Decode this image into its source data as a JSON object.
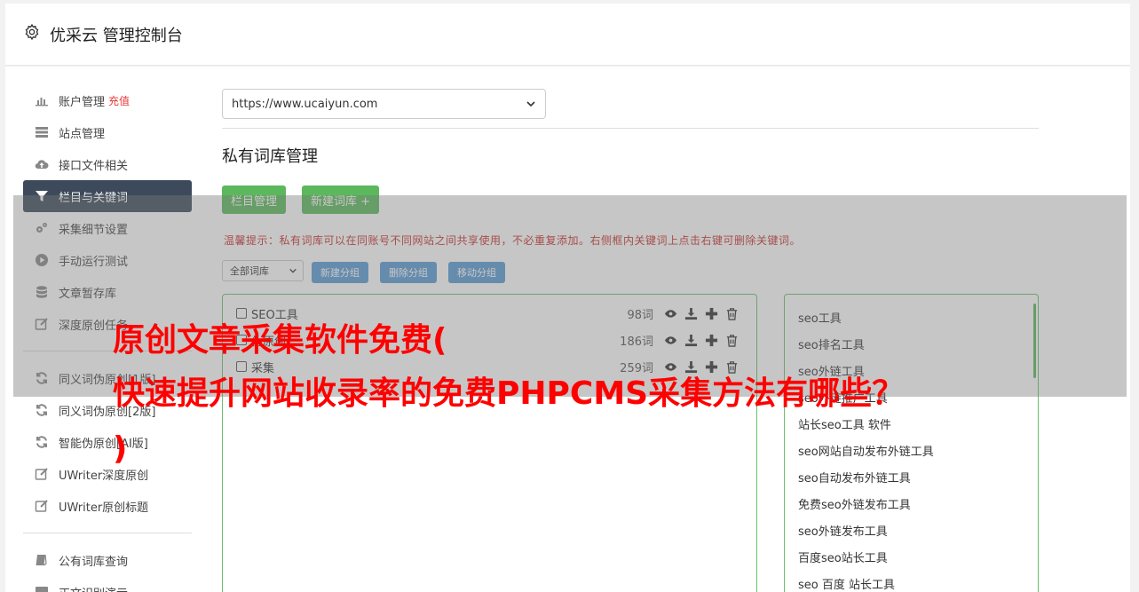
{
  "header": {
    "title": "优采云 管理控制台"
  },
  "sidebar": {
    "items": [
      {
        "label": "账户管理",
        "badge": "充值",
        "icon": "bar-chart-icon"
      },
      {
        "label": "站点管理",
        "icon": "server-icon"
      },
      {
        "label": "接口文件相关",
        "icon": "cloud-upload-icon"
      },
      {
        "label": "栏目与关键词",
        "icon": "filter-icon",
        "active": true
      },
      {
        "label": "采集细节设置",
        "icon": "gears-icon"
      },
      {
        "label": "手动运行测试",
        "icon": "play-circle-icon"
      },
      {
        "label": "文章暂存库",
        "icon": "database-icon"
      },
      {
        "label": "深度原创任务",
        "icon": "edit-icon"
      }
    ],
    "items2": [
      {
        "label": "同义词伪原创[1版]",
        "icon": "refresh-icon"
      },
      {
        "label": "同义词伪原创[2版]",
        "icon": "refresh-icon"
      },
      {
        "label": "智能伪原创[AI版]",
        "icon": "refresh-icon"
      },
      {
        "label": "UWriter深度原创",
        "icon": "edit-icon"
      },
      {
        "label": "UWriter原创标题",
        "icon": "edit-icon"
      }
    ],
    "items3": [
      {
        "label": "公有词库查询",
        "icon": "book-icon"
      },
      {
        "label": "正文识别演示",
        "icon": "monitor-icon"
      }
    ]
  },
  "main": {
    "site_select": "https://www.ucaiyun.com",
    "section_title": "私有词库管理",
    "btn_columns": "栏目管理",
    "btn_new_lib": "新建词库 +",
    "tip": "温馨提示：私有词库可以在同账号不同网站之间共享使用，不必重复添加。右侧框内关键词上点击右键可删除关键词。",
    "filter_select": "全部词库",
    "btn_new_group": "新建分组",
    "btn_delete_group": "删除分组",
    "btn_move_group": "移动分组",
    "libraries": [
      {
        "name": "SEO工具",
        "count": "98词"
      },
      {
        "name": "伪原创",
        "count": "186词"
      },
      {
        "name": "采集",
        "count": "259词"
      }
    ],
    "keywords": [
      "seo工具",
      "seo排名工具",
      "seo外链工具",
      "seo外链推广工具",
      "站长seo工具 软件",
      "seo网站自动发布外链工具",
      "seo自动发布外链工具",
      "免费seo外链发布工具",
      "seo外链发布工具",
      "百度seo站长工具",
      "seo 百度 站长工具"
    ]
  },
  "overlay": {
    "line1": "原创文章采集软件免费(",
    "line2": "快速提升网站收录率的免费PHPCMS采集方法有哪些？",
    "line3": ")"
  },
  "colors": {
    "active_nav": "#3d4a5c",
    "green_button": "#5cb85c",
    "blue_button": "#5b9bd5",
    "headline_red": "#ff0000",
    "tip_red": "#c9302c"
  }
}
